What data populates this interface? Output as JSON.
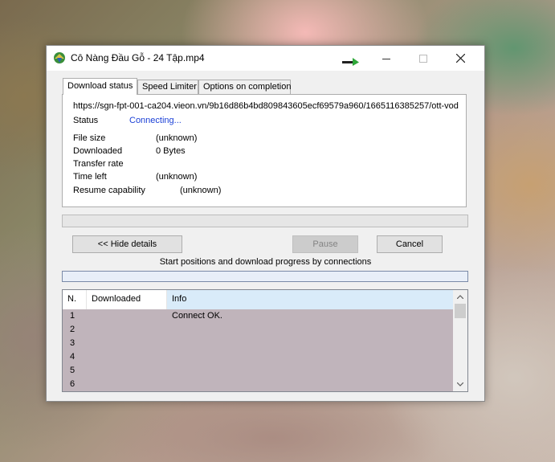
{
  "window": {
    "title": "Cô Nàng Đầu Gỗ - 24 Tập.mp4"
  },
  "tabs": [
    {
      "label": "Download status",
      "active": true
    },
    {
      "label": "Speed Limiter",
      "active": false
    },
    {
      "label": "Options on completion",
      "active": false
    }
  ],
  "status": {
    "url": "https://sgn-fpt-001-ca204.vieon.vn/9b16d86b4bd809843605ecf69579a960/1665116385257/ott-vod",
    "status_label": "Status",
    "status_value": "Connecting...",
    "file_size_label": "File size",
    "file_size_value": "(unknown)",
    "downloaded_label": "Downloaded",
    "downloaded_value": "0 Bytes",
    "transfer_rate_label": "Transfer rate",
    "transfer_rate_value": "",
    "time_left_label": "Time left",
    "time_left_value": "(unknown)",
    "resume_label": "Resume capability",
    "resume_value": "(unknown)"
  },
  "progress": {
    "main_percent": 0,
    "connections_percent": 0
  },
  "buttons": {
    "hide_details": "<< Hide details",
    "pause": "Pause",
    "cancel": "Cancel"
  },
  "connections_caption": "Start positions and download progress by connections",
  "connections_table": {
    "columns": [
      "N.",
      "Downloaded",
      "Info"
    ],
    "rows": [
      {
        "n": "1",
        "downloaded": "",
        "info": "Connect OK."
      },
      {
        "n": "2",
        "downloaded": "",
        "info": ""
      },
      {
        "n": "3",
        "downloaded": "",
        "info": ""
      },
      {
        "n": "4",
        "downloaded": "",
        "info": ""
      },
      {
        "n": "5",
        "downloaded": "",
        "info": ""
      },
      {
        "n": "6",
        "downloaded": "",
        "info": ""
      }
    ]
  },
  "colors": {
    "status_link": "#1a3fd6",
    "list_background": "#c0b4bb",
    "header_selected": "#d9ebf9",
    "arrow_green": "#2fa83a"
  }
}
